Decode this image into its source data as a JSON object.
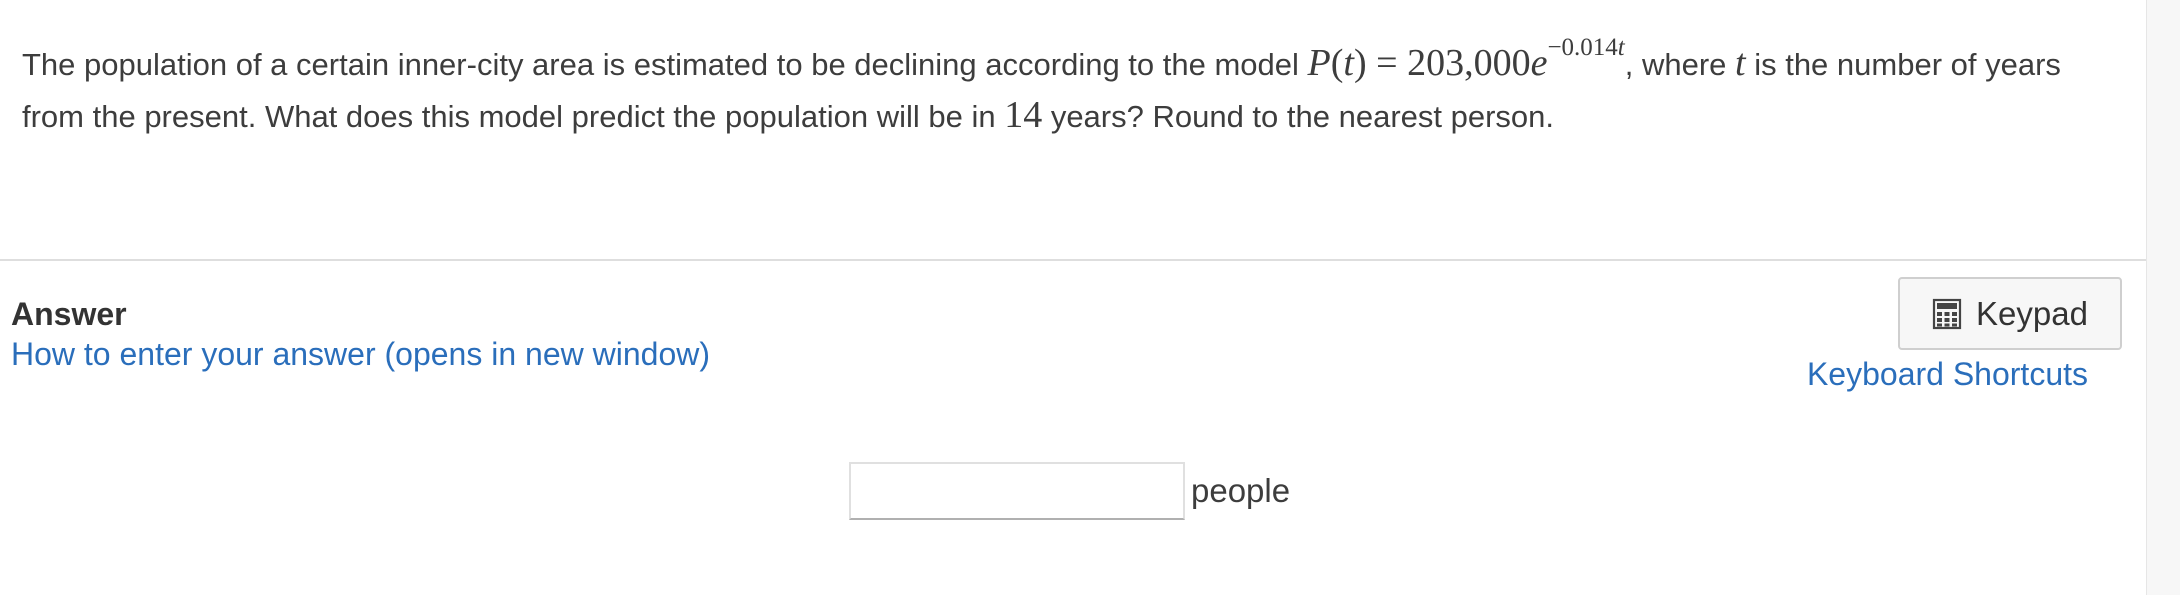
{
  "question": {
    "intro": "The population of a certain inner-city area is estimated to be declining according to the model ",
    "equation": {
      "lhs_func": "P",
      "lhs_var": "t",
      "equals": "=",
      "coefficient": "203,000",
      "base": "e",
      "exponent_value": "−0.014",
      "exponent_var": "t"
    },
    "after_equation": ", where ",
    "var_name": "t",
    "var_description": " is the number of years from the present.  What does this model predict the population will be in ",
    "years_value": "14",
    "closing": " years?  Round to the nearest person."
  },
  "answer": {
    "heading": "Answer",
    "help_link": "How to enter your answer (opens in new window)",
    "keypad_label": "Keypad",
    "shortcuts_link": "Keyboard Shortcuts",
    "input_value": "",
    "input_placeholder": "",
    "unit": "people"
  }
}
